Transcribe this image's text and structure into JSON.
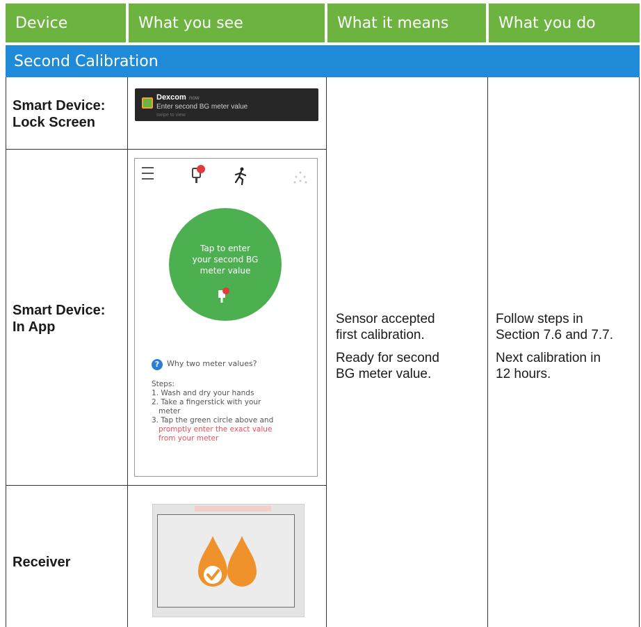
{
  "table": {
    "headers": [
      "Device",
      "What you see",
      "What it means",
      "What you do"
    ],
    "section_title": "Second Calibration",
    "rows": [
      {
        "device": [
          "Smart Device:",
          "Lock Screen"
        ]
      },
      {
        "device": [
          "Smart Device:",
          "In App"
        ]
      },
      {
        "device": [
          "Receiver"
        ]
      }
    ],
    "what_it_means": [
      "Sensor accepted",
      "first calibration.",
      "Ready for second",
      "BG meter value."
    ],
    "what_you_do": [
      "Follow steps in",
      "Section 7.6 and 7.7.",
      "Next calibration in",
      "12 hours."
    ]
  },
  "lock_screen": {
    "app_name": "Dexcom",
    "time": "now",
    "message": "Enter second BG meter value",
    "hint": "swipe to view"
  },
  "app_screen": {
    "circle_text": [
      "Tap to enter",
      "your second BG",
      "meter value"
    ],
    "why_link": "Why two meter values?",
    "steps_label": "Steps:",
    "step1": "1. Wash and dry your hands",
    "step2a": "2. Take a fingerstick with your",
    "step2b": "meter",
    "step3a": "3. Tap the green circle above and",
    "step3b": "promptly enter the exact value",
    "step3c": "from your meter"
  },
  "receiver": {
    "ticks": [
      "",
      "",
      ""
    ]
  },
  "colors": {
    "header_green": "#6cb33f",
    "section_blue": "#1f8bd8",
    "circle_green": "#4caf50",
    "drop_orange": "#f0922b",
    "alert_red": "#e23b3b"
  },
  "icons": {
    "lock_app": "dexcom-app-icon",
    "menu": "menu-icon",
    "meter": "blood-meter-icon",
    "exercise": "exercise-icon",
    "sensor": "sensor-dots-icon",
    "help": "question-icon",
    "receiver_drops": "calibration-drops-icon"
  }
}
